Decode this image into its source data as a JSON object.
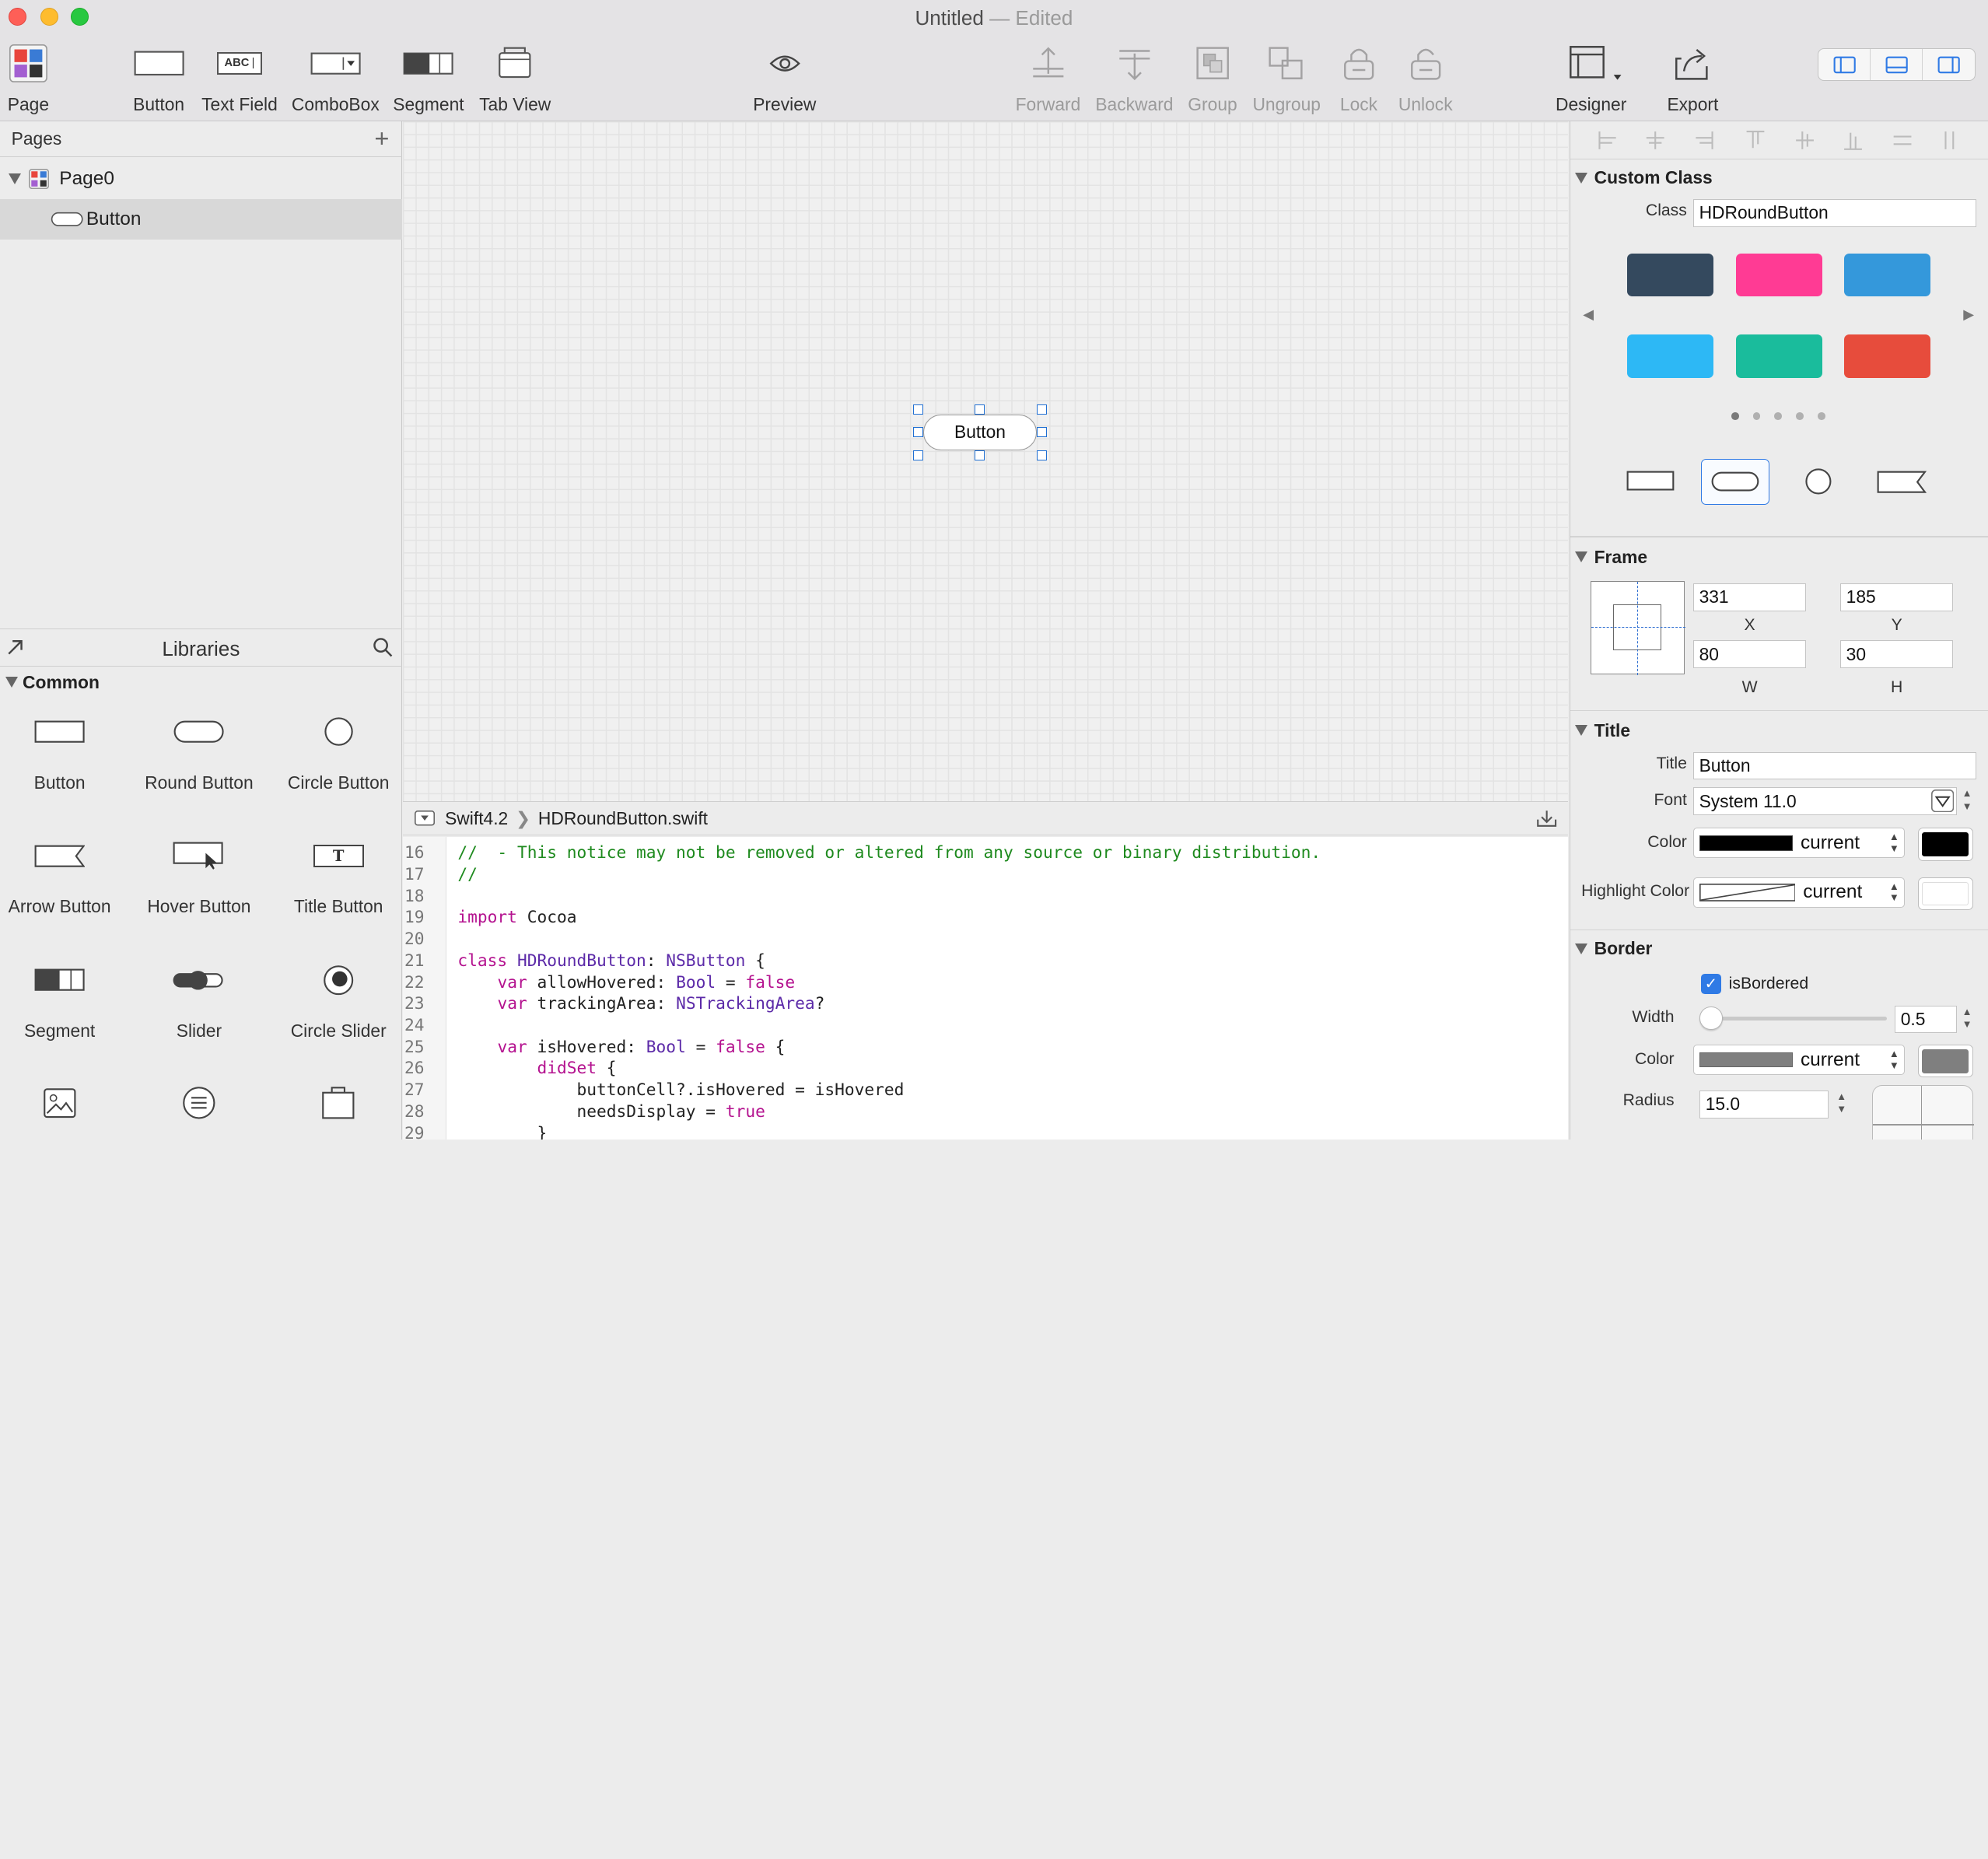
{
  "window": {
    "title": "Untitled",
    "title_suffix": "— Edited"
  },
  "toolbar": {
    "page": "Page",
    "button": "Button",
    "text_field": "Text Field",
    "text_field_icon": "ABC",
    "combobox": "ComboBox",
    "segment": "Segment",
    "tab_view": "Tab View",
    "preview": "Preview",
    "forward": "Forward",
    "backward": "Backward",
    "group": "Group",
    "ungroup": "Ungroup",
    "lock": "Lock",
    "unlock": "Unlock",
    "designer": "Designer",
    "export": "Export"
  },
  "pages": {
    "header": "Pages",
    "page0": "Page0",
    "child": "Button"
  },
  "libraries": {
    "header": "Libraries",
    "section": "Common",
    "items": [
      "Button",
      "Round Button",
      "Circle Button",
      "Arrow Button",
      "Hover Button",
      "Title Button",
      "Segment",
      "Slider",
      "Circle Slider"
    ],
    "title_button_glyph": "T"
  },
  "canvas": {
    "button_title": "Button"
  },
  "editor": {
    "breadcrumb_lang": "Swift4.2",
    "breadcrumb_file": "HDRoundButton.swift",
    "lines": [
      {
        "n": "16",
        "t": "//  - This notice may not be removed or altered from any source or binary distribution."
      },
      {
        "n": "17",
        "t": "//"
      },
      {
        "n": "18",
        "t": ""
      },
      {
        "n": "19",
        "kw": "import",
        "rest": " Cocoa"
      },
      {
        "n": "20",
        "t": ""
      },
      {
        "n": "21",
        "kw": "class",
        "name": " HDRoundButton",
        "p": ": ",
        "ty": "NSButton",
        "end": " {"
      },
      {
        "n": "22",
        "ind": "    ",
        "kw": "var",
        "name": " allowHovered",
        "p": ": ",
        "ty": "Bool",
        "mid": " = ",
        "kw2": "false"
      },
      {
        "n": "23",
        "ind": "    ",
        "kw": "var",
        "name": " trackingArea",
        "p": ": ",
        "ty": "NSTrackingArea",
        "end": "?"
      },
      {
        "n": "24",
        "t": ""
      },
      {
        "n": "25",
        "ind": "    ",
        "kw": "var",
        "name": " isHovered",
        "p": ": ",
        "ty": "Bool",
        "mid": " = ",
        "kw2": "false",
        "end": " {"
      },
      {
        "n": "26",
        "ind": "        ",
        "kw": "didSet",
        "end": " {"
      },
      {
        "n": "27",
        "ind": "            ",
        "rest": "buttonCell?.isHovered = isHovered"
      },
      {
        "n": "28",
        "ind": "            ",
        "rest": "needsDisplay = ",
        "kw2": "true"
      },
      {
        "n": "29",
        "ind": "        ",
        "rest": "}"
      }
    ]
  },
  "inspector": {
    "custom_class": {
      "header": "Custom Class",
      "class_label": "Class",
      "class_value": "HDRoundButton",
      "swatches": [
        "#34495e",
        "#ff3b94",
        "#3498db",
        "#2db8f5",
        "#1abc9c",
        "#e74c3c"
      ],
      "page_dots": 5,
      "active_dot": 0
    },
    "frame": {
      "header": "Frame",
      "x": "331",
      "y": "185",
      "w": "80",
      "h": "30",
      "x_label": "X",
      "y_label": "Y",
      "w_label": "W",
      "h_label": "H"
    },
    "title": {
      "header": "Title",
      "title_label": "Title",
      "title_value": "Button",
      "font_label": "Font",
      "font_value": "System  11.0",
      "color_label": "Color",
      "color_value": "current",
      "color_hex": "#000000",
      "highlight_label": "Highlight Color",
      "highlight_value": "current"
    },
    "border": {
      "header": "Border",
      "is_bordered_label": "isBordered",
      "is_bordered": true,
      "width_label": "Width",
      "width_value": "0.5",
      "color_label": "Color",
      "color_value": "current",
      "color_hex": "#7f7f7f",
      "radius_label": "Radius",
      "radius_value": "15.0"
    }
  },
  "colors": {
    "accent": "#1f6fd3"
  }
}
